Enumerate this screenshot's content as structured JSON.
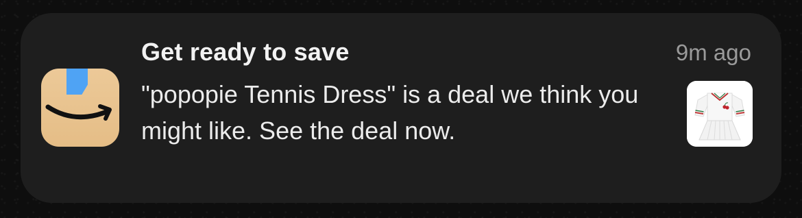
{
  "notification": {
    "app_icon": "amazon-shopping-icon",
    "title": "Get ready to save",
    "timestamp": "9m ago",
    "body": "\"popopie Tennis Dress\" is a deal we think you might like. See the deal now.",
    "thumbnail": "tennis-dress-thumbnail"
  },
  "colors": {
    "background": "#0e0e0e",
    "card": "#1e1e1e",
    "icon_tan": "#e8c28f",
    "icon_blue": "#4fa3f4"
  }
}
